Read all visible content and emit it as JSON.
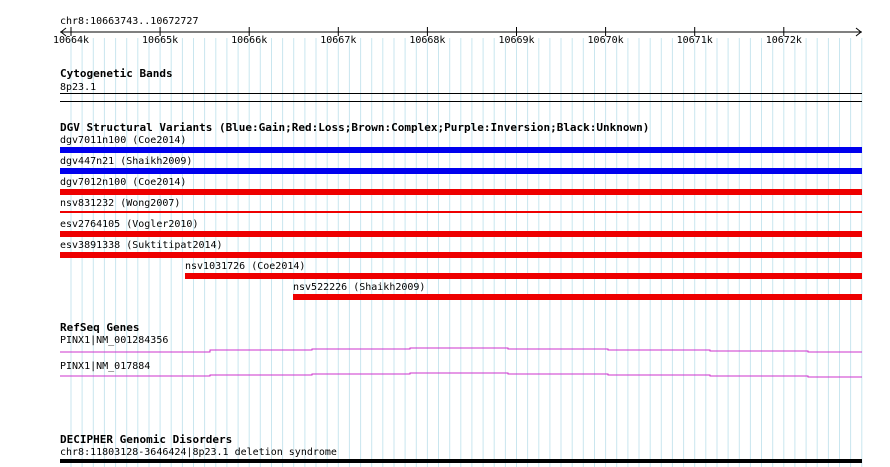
{
  "region": "chr8:10663743..10672727",
  "ruler": {
    "ticks": [
      "10664k",
      "10665k",
      "10666k",
      "10667k",
      "10668k",
      "10669k",
      "10670k",
      "10671k",
      "10672k"
    ]
  },
  "tracks": {
    "cytobands": {
      "title": "Cytogenetic Bands",
      "band_label": "8p23.1"
    },
    "dgv": {
      "title": "DGV Structural Variants (Blue:Gain;Red:Loss;Brown:Complex;Purple:Inversion;Black:Unknown)",
      "colors": {
        "gain": "#0000ee",
        "loss": "#ee0000",
        "thin_loss": "#ee0000"
      },
      "items": [
        {
          "label": "dgv7011n100 (Coe2014)",
          "type": "gain"
        },
        {
          "label": "dgv447n21 (Shaikh2009)",
          "type": "gain"
        },
        {
          "label": "dgv7012n100 (Coe2014)",
          "type": "loss"
        },
        {
          "label": "nsv831232 (Wong2007)",
          "type": "thin_loss"
        },
        {
          "label": "esv2764105 (Vogler2010)",
          "type": "loss"
        },
        {
          "label": "esv3891338 (Suktitipat2014)",
          "type": "loss"
        },
        {
          "label": "nsv1031726 (Coe2014)",
          "type": "loss"
        },
        {
          "label": "nsv522226 (Shaikh2009)",
          "type": "loss"
        }
      ]
    },
    "refseq": {
      "title": "RefSeq Genes",
      "color": "#cc33cc",
      "genes": [
        {
          "label": "PINX1|NM_001284356"
        },
        {
          "label": "PINX1|NM_017884"
        }
      ]
    },
    "decipher": {
      "title": "DECIPHER Genomic Disorders",
      "item_label": "chr8:11803128-3646424|8p23.1 deletion syndrome"
    }
  }
}
